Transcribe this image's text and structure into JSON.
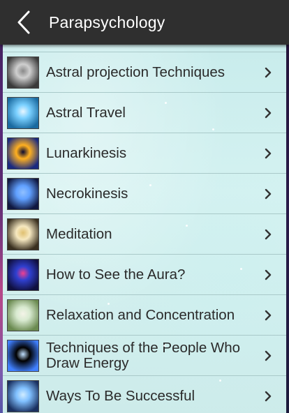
{
  "appbar": {
    "title": "Parapsychology",
    "back_icon": "chevron-left-icon"
  },
  "list": {
    "items": [
      {
        "label": "Astral projection Techniques",
        "thumb": "astral-projection-image",
        "colors": [
          "#cfcfcf",
          "#3a3a3a",
          "#8a8a8a"
        ]
      },
      {
        "label": "Astral Travel",
        "thumb": "astral-travel-image",
        "colors": [
          "#7ad0ff",
          "#1a6aa0",
          "#e8f6ff"
        ]
      },
      {
        "label": "Lunarkinesis",
        "thumb": "lunarkinesis-image",
        "colors": [
          "#ffb020",
          "#1a2a80",
          "#0a0a30"
        ]
      },
      {
        "label": "Necrokinesis",
        "thumb": "necrokinesis-image",
        "colors": [
          "#60a0ff",
          "#101840",
          "#90c0ff"
        ]
      },
      {
        "label": "Meditation",
        "thumb": "meditation-image",
        "colors": [
          "#f6e8c0",
          "#3a3020",
          "#e0c070"
        ]
      },
      {
        "label": "How to See the Aura?",
        "thumb": "aura-image",
        "colors": [
          "#3040d0",
          "#101040",
          "#f04090"
        ]
      },
      {
        "label": "Relaxation and Concentration",
        "thumb": "relaxation-image",
        "colors": [
          "#d8ead0",
          "#6a8a50",
          "#f4f4e8"
        ]
      },
      {
        "label": "Techniques of the People Who Draw Energy",
        "thumb": "draw-energy-image",
        "colors": [
          "#000000",
          "#4080ff",
          "#c0e0ff"
        ]
      },
      {
        "label": "Ways To Be Successful",
        "thumb": "successful-image",
        "colors": [
          "#80c0ff",
          "#1a3060",
          "#d0ecff"
        ]
      }
    ]
  }
}
